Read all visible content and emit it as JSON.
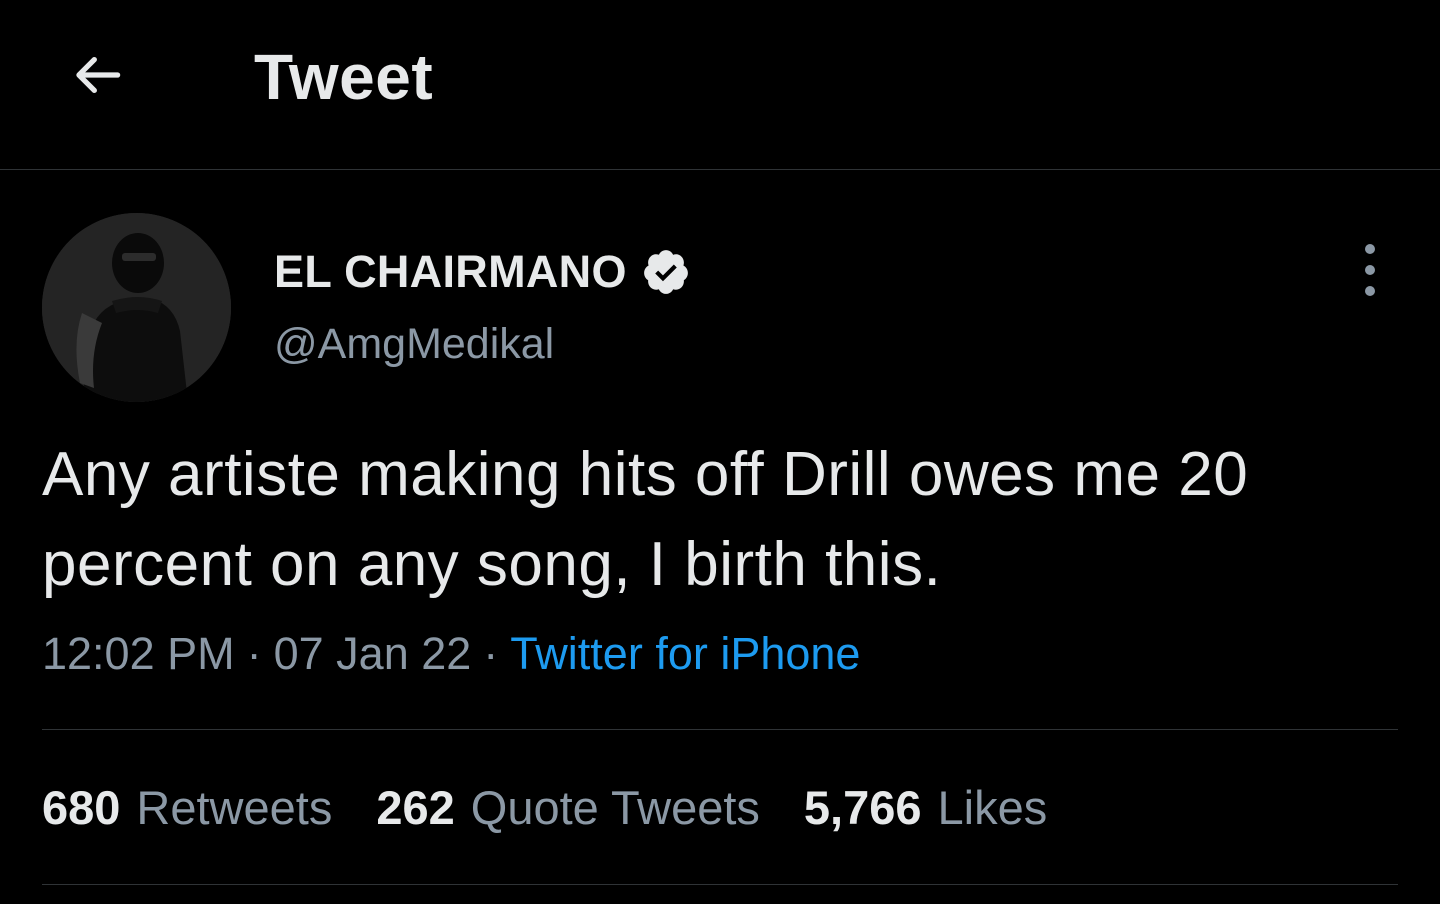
{
  "header": {
    "title": "Tweet",
    "back_icon": "arrow-left-icon"
  },
  "author": {
    "display_name": "EL CHAIRMANO",
    "handle": "@AmgMedikal",
    "verified": true,
    "verified_icon": "verified-badge-icon",
    "avatar_icon": "profile-photo"
  },
  "more_icon": "more-vertical-icon",
  "tweet": {
    "text": "Any artiste making hits off Drill owes me 20 percent on any song, I birth this.",
    "time": "12:02 PM",
    "date": "07 Jan 22",
    "separator": "·",
    "source": "Twitter for iPhone"
  },
  "stats": [
    {
      "count": "680",
      "label": "Retweets"
    },
    {
      "count": "262",
      "label": "Quote Tweets"
    },
    {
      "count": "5,766",
      "label": "Likes"
    }
  ],
  "colors": {
    "background": "#000000",
    "text_primary": "#e7e9ea",
    "text_secondary": "#8b98a5",
    "accent": "#1d9bf0",
    "divider": "#2f3336"
  }
}
